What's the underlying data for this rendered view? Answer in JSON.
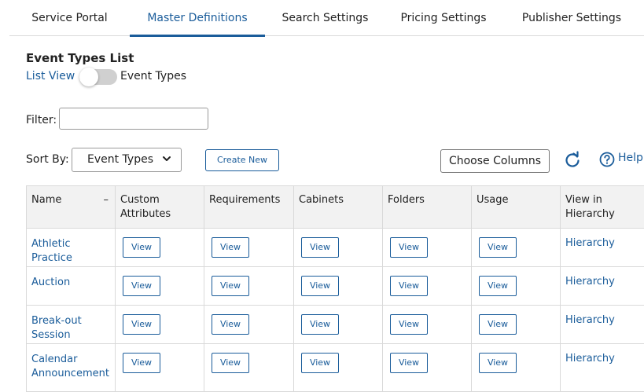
{
  "nav": {
    "tabs": [
      {
        "label": "Service Portal",
        "active": false
      },
      {
        "label": "Master Definitions",
        "active": true
      },
      {
        "label": "Search Settings",
        "active": false
      },
      {
        "label": "Pricing Settings",
        "active": false
      },
      {
        "label": "Publisher Settings",
        "active": false
      }
    ]
  },
  "page": {
    "title": "Event Types List",
    "list_view_label": "List View",
    "toggle_label": "Event Types",
    "filter_label": "Filter:",
    "filter_value": "",
    "sort_label": "Sort By:",
    "sort_value": "Event Types",
    "create_new_label": "Create New",
    "choose_columns_label": "Choose Columns",
    "help_label": "Help"
  },
  "table": {
    "columns": [
      "Name",
      "Custom Attributes",
      "Requirements",
      "Cabinets",
      "Folders",
      "Usage",
      "View in Hierarchy"
    ],
    "sort_indicator": "–",
    "view_label": "View",
    "hierarchy_label": "Hierarchy",
    "rows": [
      {
        "name": "Athletic Practice"
      },
      {
        "name": "Auction"
      },
      {
        "name": "Break-out Session"
      },
      {
        "name": "Calendar Announcement"
      }
    ]
  },
  "colors": {
    "accent": "#1a5c9a",
    "header_bg": "#f2f2f2",
    "border": "#d9d9d9"
  },
  "icons": [
    "refresh-icon",
    "help-circle-icon",
    "chevron-down-icon"
  ]
}
